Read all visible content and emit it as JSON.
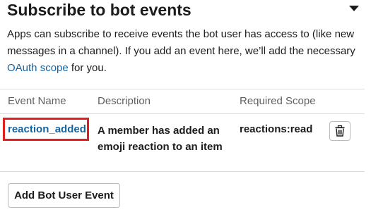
{
  "section": {
    "title": "Subscribe to bot events",
    "description_before_link": "Apps can subscribe to receive events the bot user has access to (like new messages in a channel). If you add an event here, we’ll add the necessary ",
    "link_text": "OAuth scope",
    "description_after_link": " for you."
  },
  "table": {
    "headers": {
      "name": "Event Name",
      "description": "Description",
      "scope": "Required Scope"
    },
    "rows": [
      {
        "name": "reaction_added",
        "description": "A member has added an emoji reaction to an item",
        "scope": "reactions:read",
        "delete_icon": "trash-icon"
      }
    ]
  },
  "add_button_label": "Add Bot User Event",
  "colors": {
    "link": "#1264a3",
    "highlight": "#e01e1e",
    "text": "#1d1c1d",
    "muted": "#616061"
  }
}
